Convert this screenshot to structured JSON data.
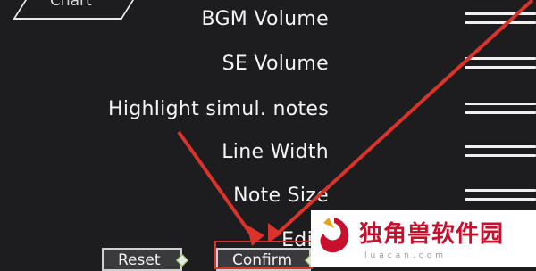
{
  "tab": {
    "label": "Chart"
  },
  "settings": [
    {
      "label": "BGM Volume"
    },
    {
      "label": "SE Volume"
    },
    {
      "label": "Highlight simul. notes"
    },
    {
      "label": "Line Width"
    },
    {
      "label": "Note Size"
    },
    {
      "label": "Edi"
    }
  ],
  "buttons": {
    "reset": "Reset",
    "confirm": "Confirm"
  },
  "watermark": {
    "title": "独角兽软件园",
    "subtitle": "luacan.com"
  },
  "colors": {
    "background": "#1d1d1f",
    "annotation": "#d9332b",
    "text": "#f2f2f2"
  },
  "icons": {
    "watermark_logo": "unicorn-logo"
  }
}
